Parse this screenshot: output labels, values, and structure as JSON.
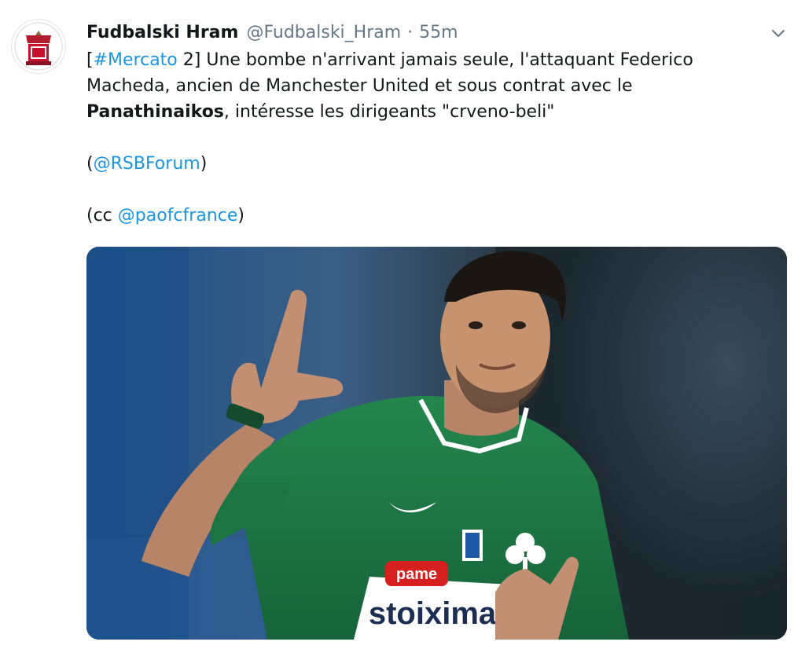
{
  "tweet": {
    "author": {
      "display_name": "Fudbalski Hram",
      "handle": "@Fudbalski_Hram",
      "separator": "·",
      "time": "55m",
      "avatar_icon": "club-crest-icon"
    },
    "menu_icon": "chevron-down-icon",
    "text": {
      "line1_bracket_open": "[",
      "hashtag": "#Mercato",
      "line1_rest": " 2] Une bombe n'arrivant jamais seule, l'attaquant Federico Macheda, ancien de Manchester United et sous contrat avec le ",
      "bold_word": "Panathinaikos",
      "line1_end": ", intéresse les dirigeants \"crveno-beli\"",
      "mention1_open": "(",
      "mention1": "@RSBForum",
      "mention1_close": ")",
      "cc_open": "(cc ",
      "mention2": "@paofcfrance",
      "cc_close": ")"
    },
    "media": {
      "description": "photo",
      "sponsor_line1": "pame",
      "sponsor_line2": "stoixima"
    }
  },
  "colors": {
    "link": "#1b95e0",
    "muted": "#657786",
    "text": "#14171a",
    "jersey": "#1f7a45",
    "crest_red": "#c8102e"
  }
}
